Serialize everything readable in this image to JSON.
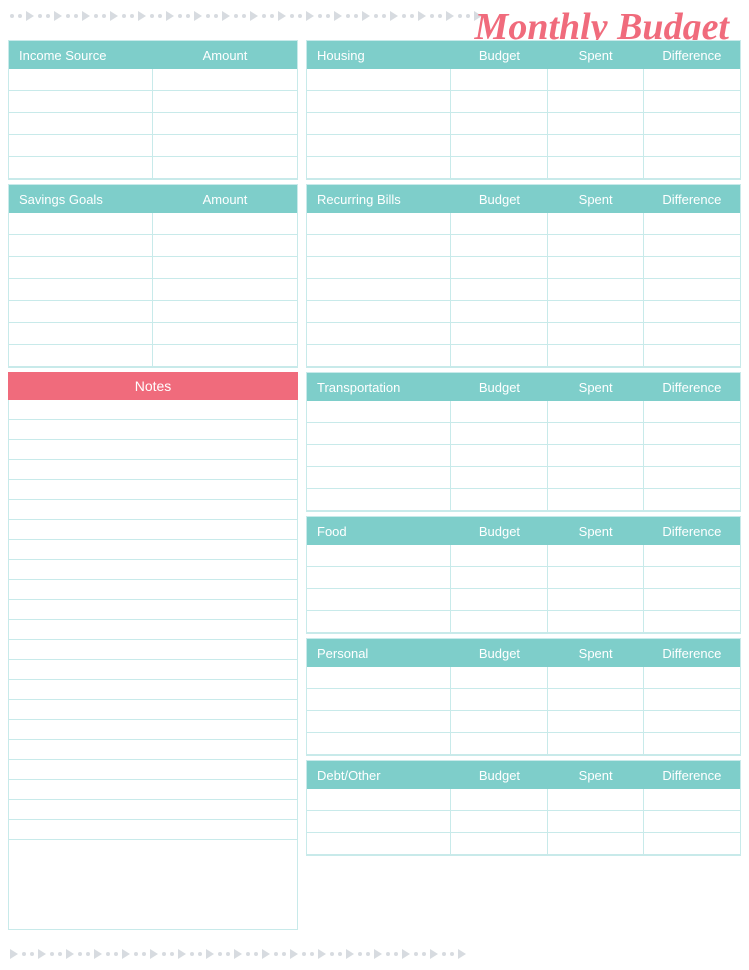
{
  "title": "Monthly Budget",
  "left": {
    "income": {
      "header": [
        "Income Source",
        "Amount"
      ],
      "rows": 5
    },
    "savings": {
      "header": [
        "Savings Goals",
        "Amount"
      ],
      "rows": 7
    },
    "notes": {
      "label": "Notes",
      "rows": 22
    }
  },
  "right": {
    "sections": [
      {
        "id": "housing",
        "header": [
          "Housing",
          "Budget",
          "Spent",
          "Difference"
        ],
        "rows": 5
      },
      {
        "id": "recurring-bills",
        "header": [
          "Recurring Bills",
          "Budget",
          "Spent",
          "Difference"
        ],
        "rows": 7
      },
      {
        "id": "transportation",
        "header": [
          "Transportation",
          "Budget",
          "Spent",
          "Difference"
        ],
        "rows": 5
      },
      {
        "id": "food",
        "header": [
          "Food",
          "Budget",
          "Spent",
          "Difference"
        ],
        "rows": 4
      },
      {
        "id": "personal",
        "header": [
          "Personal",
          "Budget",
          "Spent",
          "Difference"
        ],
        "rows": 4
      },
      {
        "id": "debt-other",
        "header": [
          "Debt/Other",
          "Budget",
          "Spent",
          "Difference"
        ],
        "rows": 3
      }
    ]
  },
  "decorative": {
    "color": "#b0b8c1"
  }
}
